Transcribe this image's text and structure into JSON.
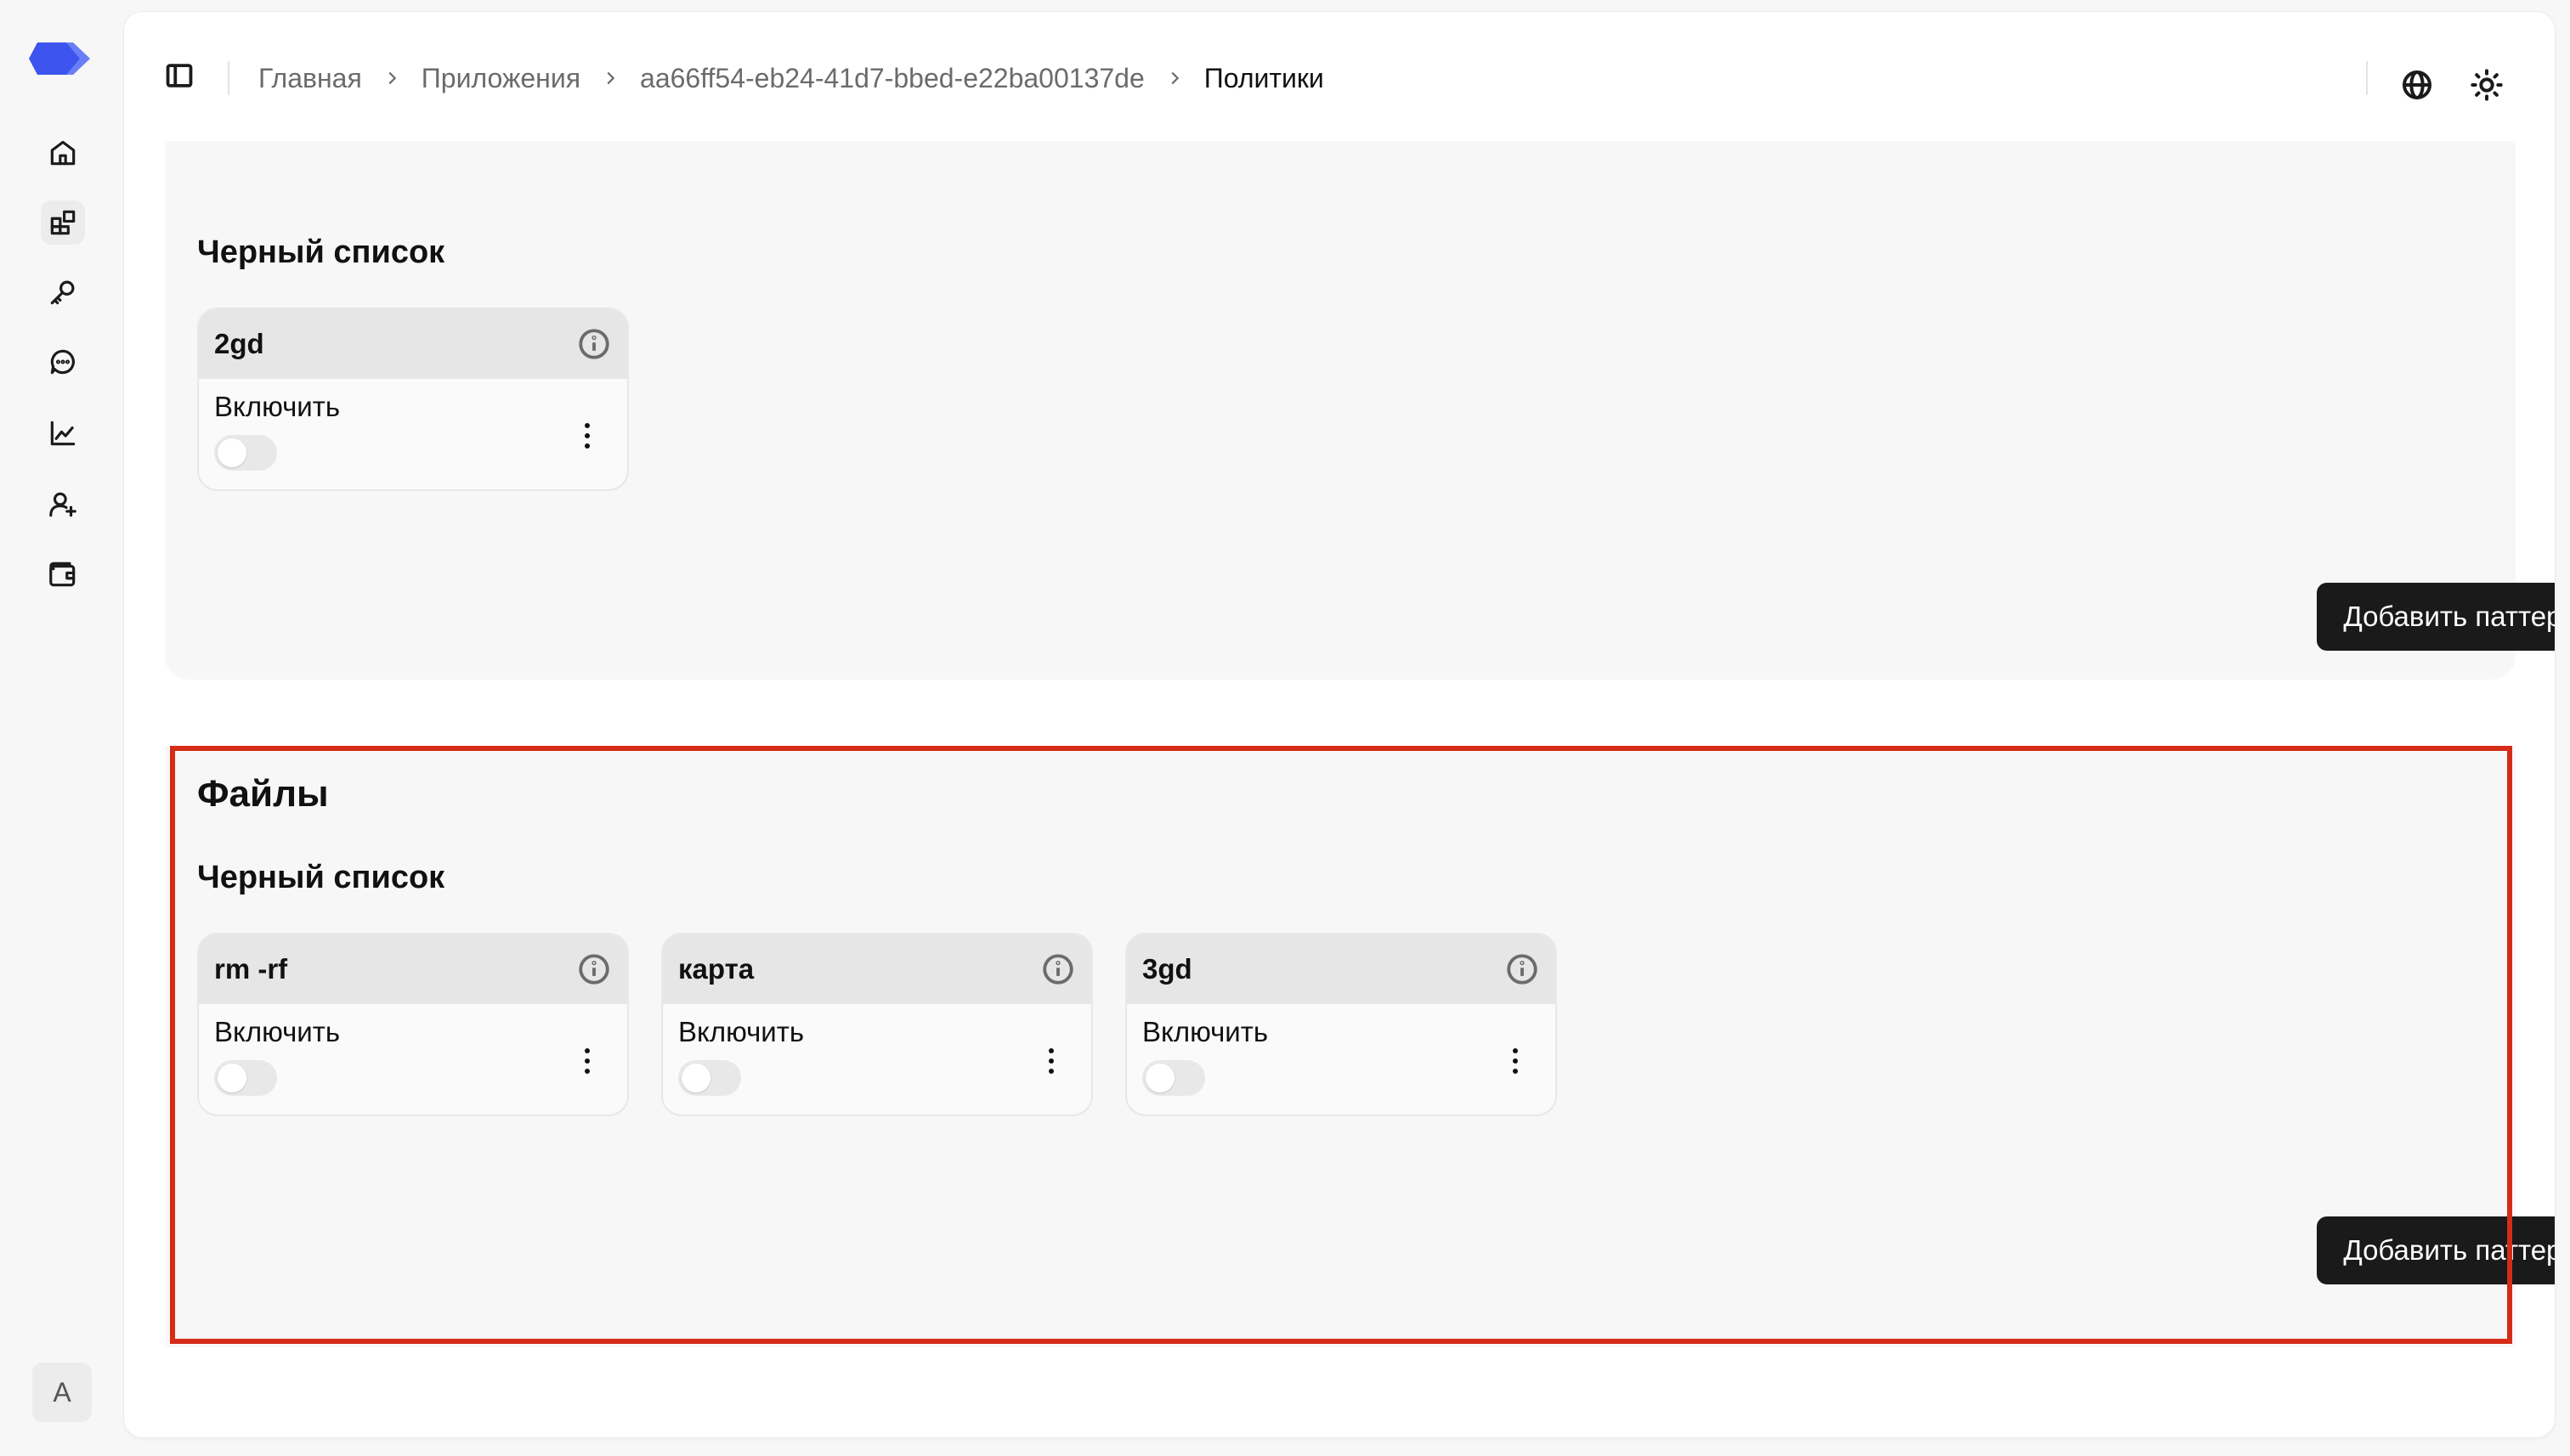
{
  "colors": {
    "accent": "#4f63f0",
    "highlight": "#d42c17",
    "button": "#1a1a1a"
  },
  "sidebar": {
    "items": [
      {
        "icon": "home-icon"
      },
      {
        "icon": "apps-icon",
        "active": true
      },
      {
        "icon": "key-icon"
      },
      {
        "icon": "chat-icon"
      },
      {
        "icon": "chart-icon"
      },
      {
        "icon": "user-plus-icon"
      },
      {
        "icon": "wallet-icon"
      }
    ],
    "avatar": "A"
  },
  "header": {
    "breadcrumb": [
      "Главная",
      "Приложения",
      "aa66ff54-eb24-41d7-bbed-e22ba00137de",
      "Политики"
    ],
    "icons": [
      "globe-icon",
      "sun-icon"
    ]
  },
  "section1": {
    "subtitle": "Черный список",
    "cards": [
      {
        "name": "2gd",
        "toggle_label": "Включить",
        "enabled": false
      }
    ],
    "add_button": "Добавить паттерн"
  },
  "section2": {
    "title": "Файлы",
    "subtitle": "Черный список",
    "cards": [
      {
        "name": "rm -rf",
        "toggle_label": "Включить",
        "enabled": false
      },
      {
        "name": "карта",
        "toggle_label": "Включить",
        "enabled": false
      },
      {
        "name": "3gd",
        "toggle_label": "Включить",
        "enabled": false
      }
    ],
    "add_button": "Добавить паттерн"
  }
}
